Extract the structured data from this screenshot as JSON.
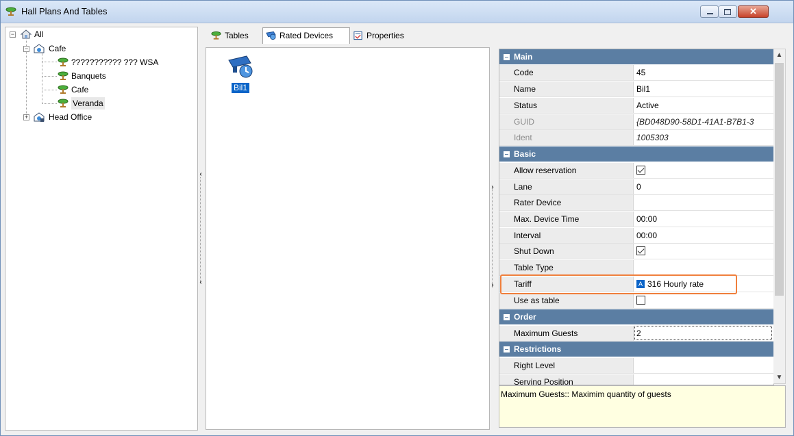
{
  "window": {
    "title": "Hall Plans And Tables",
    "close_glyph": "✕"
  },
  "tree": {
    "root": "All",
    "children": [
      {
        "label": "Cafe",
        "children": [
          "??????????? ??? WSA",
          "Banquets",
          "Cafe",
          "Veranda"
        ]
      },
      {
        "label": "Head Office"
      }
    ]
  },
  "tabs": [
    {
      "label": "Tables",
      "icon": "table-icon"
    },
    {
      "label": "Rated Devices",
      "icon": "rated-device-icon"
    },
    {
      "label": "Properties",
      "icon": "properties-icon"
    }
  ],
  "device": {
    "label": "Bil1",
    "icon": "rated-device-icon"
  },
  "properties": {
    "categories": {
      "main": "Main",
      "basic": "Basic",
      "order": "Order",
      "restrictions": "Restrictions"
    },
    "main": {
      "code": {
        "name": "Code",
        "value": "45"
      },
      "name": {
        "name": "Name",
        "value": "Bil1"
      },
      "status": {
        "name": "Status",
        "value": "Active"
      },
      "guid": {
        "name": "GUID",
        "value": "{BD048D90-58D1-41A1-B7B1-3"
      },
      "ident": {
        "name": "Ident",
        "value": "1005303"
      }
    },
    "basic": {
      "allow_reservation": {
        "name": "Allow reservation",
        "checked": true
      },
      "lane": {
        "name": "Lane",
        "value": "0"
      },
      "rater_device": {
        "name": "Rater Device",
        "value": ""
      },
      "max_device_time": {
        "name": "Max. Device Time",
        "value": "00:00"
      },
      "interval": {
        "name": "Interval",
        "value": "00:00"
      },
      "shut_down": {
        "name": "Shut Down",
        "checked": true
      },
      "table_type": {
        "name": "Table Type",
        "value": ""
      },
      "tariff": {
        "name": "Tariff",
        "value": "316 Hourly rate",
        "badge": "A"
      },
      "use_as_table": {
        "name": "Use as table",
        "checked": false
      }
    },
    "order": {
      "maximum_guests": {
        "name": "Maximum Guests",
        "value": "2"
      }
    },
    "restrictions": {
      "right_level": {
        "name": "Right Level",
        "value": ""
      },
      "serving_position": {
        "name": "Serving Position",
        "value": ""
      }
    }
  },
  "help": {
    "text": "Maximum Guests:: Maximim quantity of guests"
  },
  "colors": {
    "category_header": "#5b7ea3",
    "highlight": "#f07f3c",
    "selection": "#0a64c8",
    "help_bg": "#ffffe1"
  }
}
